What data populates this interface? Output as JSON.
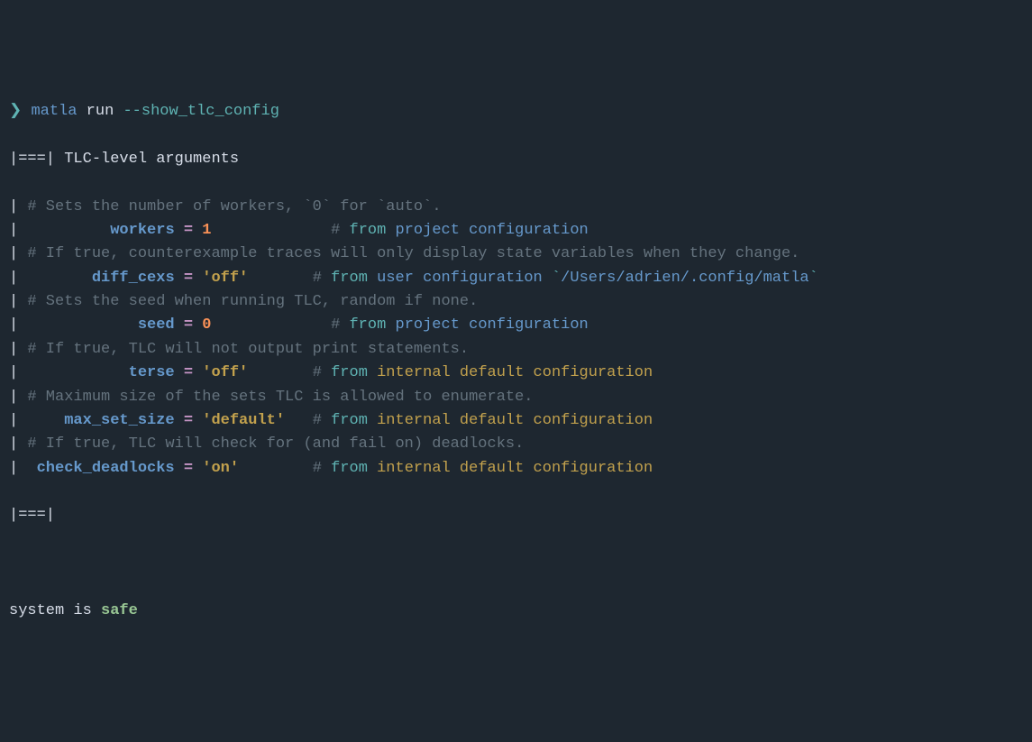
{
  "prompt": {
    "arrow": "❯",
    "command": "matla",
    "subcommand": "run",
    "flag": "--show_tlc_config"
  },
  "header": {
    "open": "|===|",
    "title": "TLC-level arguments",
    "close": "|===|"
  },
  "bar": "|",
  "hash": "#",
  "from": "from",
  "items": [
    {
      "desc_pre": "Sets the number of workers, ",
      "desc_code": "`0`",
      "desc_mid": " for ",
      "desc_code2": "`auto`",
      "desc_post": ".",
      "key": "workers",
      "value": "1",
      "value_type": "num",
      "key_col": "          workers",
      "val_col": "1             ",
      "source_type": "proj",
      "source": "project configuration"
    },
    {
      "desc_pre": "If true, counterexample traces will only display state variables when they change.",
      "key": "diff_cexs",
      "value": "'off'",
      "value_type": "str",
      "key_col": "        diff_cexs",
      "val_col": "'off'       ",
      "source_type": "user",
      "source": "user configuration",
      "path": "/Users/adrien/.config/matla"
    },
    {
      "desc_pre": "Sets the seed when running TLC, random if none.",
      "key": "seed",
      "value": "0",
      "value_type": "num",
      "key_col": "             seed",
      "val_col": "0             ",
      "source_type": "proj",
      "source": "project configuration"
    },
    {
      "desc_pre": "If true, TLC will not output print statements.",
      "key": "terse",
      "value": "'off'",
      "value_type": "str",
      "key_col": "            terse",
      "val_col": "'off'       ",
      "source_type": "internal",
      "source": "internal default configuration"
    },
    {
      "desc_pre": "Maximum size of the sets TLC is allowed to enumerate.",
      "key": "max_set_size",
      "value": "'default'",
      "value_type": "str",
      "key_col": "     max_set_size",
      "val_col": "'default'   ",
      "source_type": "internal",
      "source": "internal default configuration"
    },
    {
      "desc_pre": "If true, TLC will check for (and fail on) deadlocks.",
      "key": "check_deadlocks",
      "value": "'on'",
      "value_type": "str",
      "key_col": "  check_deadlocks",
      "val_col": "'on'        ",
      "source_type": "internal",
      "source": "internal default configuration"
    }
  ],
  "result": {
    "prefix": "system is ",
    "status": "safe"
  }
}
